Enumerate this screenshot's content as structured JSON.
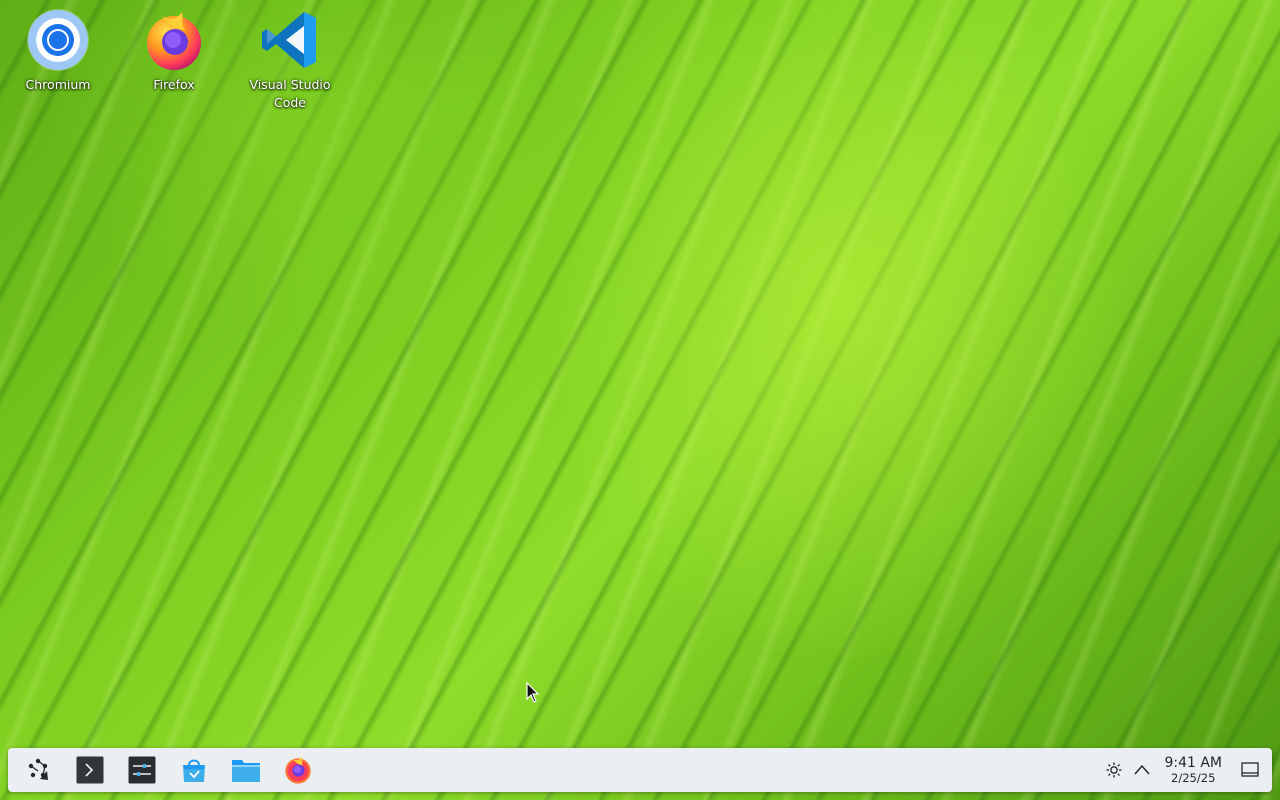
{
  "desktop": {
    "icons": [
      {
        "label": "Chromium",
        "icon": "chromium-icon"
      },
      {
        "label": "Firefox",
        "icon": "firefox-icon"
      },
      {
        "label": "Visual Studio Code",
        "icon": "vscode-icon"
      }
    ]
  },
  "taskbar": {
    "launchers": [
      {
        "name": "application-launcher",
        "icon": "kde-launcher-icon"
      },
      {
        "name": "terminal",
        "icon": "terminal-icon"
      },
      {
        "name": "system-settings",
        "icon": "settings-icon"
      },
      {
        "name": "discover-store",
        "icon": "store-icon"
      },
      {
        "name": "file-manager",
        "icon": "folder-icon"
      },
      {
        "name": "firefox",
        "icon": "firefox-icon"
      }
    ],
    "tray": {
      "brightness_icon": "brightness-icon",
      "expand_icon": "chevron-up-icon",
      "time": "9:41 AM",
      "date": "2/25/25",
      "show_desktop_icon": "show-desktop-icon"
    }
  },
  "colors": {
    "panel_bg": "#eceff1",
    "wallpaper_green": "#7fd021",
    "chromium_blue": "#4285f4",
    "vscode_blue": "#0f74c0",
    "firefox_orange": "#ff7139"
  }
}
